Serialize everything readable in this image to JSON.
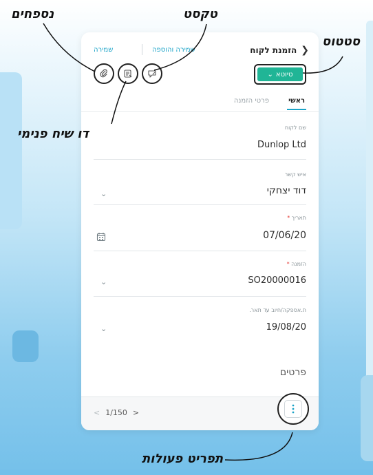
{
  "callouts": {
    "attachments": "נספחים",
    "text": "טקסט",
    "status": "סטטוס",
    "internal_memo": "דו שיח פנימי",
    "actions_menu": "תפריט פעולות"
  },
  "header": {
    "back_icon": "chevron-left-icon",
    "title": "הזמנת לקוח",
    "save_and_add": "שמירה והוספה",
    "save": "שמירה"
  },
  "toolbar": {
    "attach_icon": "paperclip-icon",
    "memo_icon": "note-icon",
    "text_icon": "chat-icon"
  },
  "status": {
    "label": "טיוטא",
    "color": "#20b596"
  },
  "tabs": [
    {
      "label": "ראשי",
      "active": true
    },
    {
      "label": "פרטי הזמנה",
      "active": false
    }
  ],
  "fields": {
    "customer_name": {
      "label": "שם לקוח",
      "value": "Dunlop Ltd"
    },
    "contact": {
      "label": "איש קשר",
      "value": "דוד יצחקי"
    },
    "date": {
      "label": "תאריך",
      "required_mark": "*",
      "value": "07/06/20"
    },
    "order": {
      "label": "הזמנה",
      "required_mark": "*",
      "value": "SO20000016"
    },
    "supply_date": {
      "label": "ת.אספקה/חיוב עד תאר.",
      "value": "19/08/20"
    },
    "items_section": "פרטים"
  },
  "footer": {
    "pager_prev": "<",
    "pager_text": "1/150",
    "pager_next": ">",
    "menu_icon": "kebab-menu-icon"
  },
  "colors": {
    "accent": "#1aa3c7",
    "status": "#20b596",
    "required": "#e53935"
  }
}
